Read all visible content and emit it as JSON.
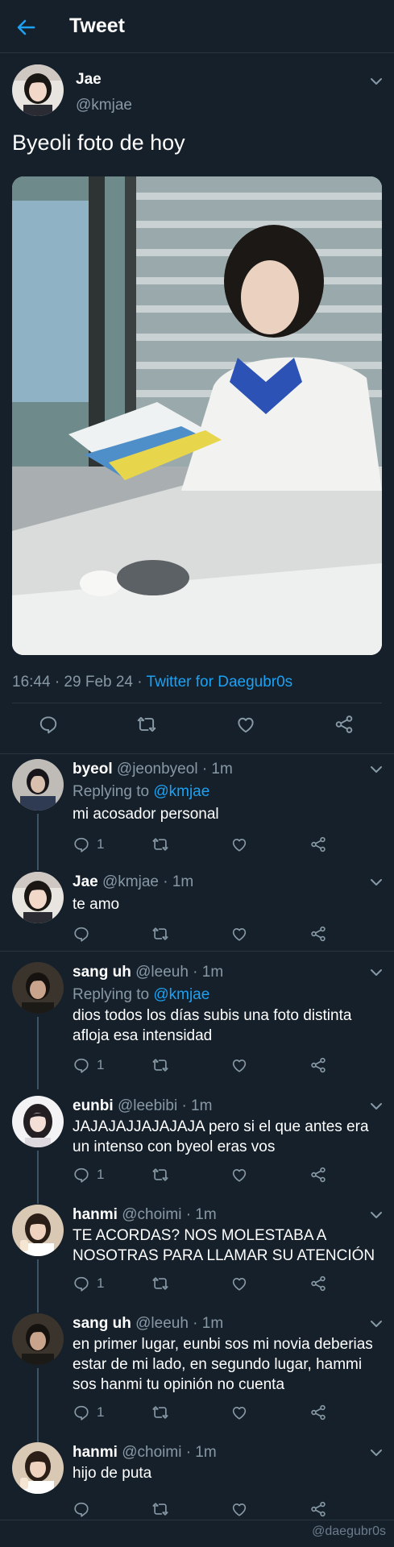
{
  "header": {
    "title": "Tweet",
    "back_icon": "arrow-left-icon",
    "accent": "#1da1f2"
  },
  "main_tweet": {
    "name": "Jae",
    "handle": "@kmjae",
    "text": "Byeoli foto de hoy",
    "time": "16:44 · 29 Feb 24 · ",
    "source": "Twitter for Daegubr0s"
  },
  "replies": [
    {
      "name": "byeol",
      "handle": "@jeonbyeol · 1m",
      "replying_prefix": "Replying to ",
      "replying_to": "@kmjae",
      "lines": [
        "mi acosador personal"
      ],
      "reply_count": "1"
    },
    {
      "name": "Jae",
      "handle": "@kmjae · 1m",
      "lines": [
        "te amo"
      ],
      "reply_count": ""
    },
    {
      "name": "sang uh",
      "handle": "@leeuh · 1m",
      "replying_prefix": "Replying to ",
      "replying_to": "@kmjae",
      "lines": [
        "dios todos los días subis una foto distinta",
        "afloja esa intensidad"
      ],
      "reply_count": "1"
    },
    {
      "name": "eunbi",
      "handle": "@leebibi · 1m",
      "lines": [
        "JAJAJAJJAJAJAJA pero si el que antes era",
        "un intenso con byeol eras vos"
      ],
      "reply_count": "1"
    },
    {
      "name": "hanmi",
      "handle": "@choimi · 1m",
      "lines": [
        "TE ACORDAS? NOS MOLESTABA A",
        "NOSOTRAS PARA LLAMAR SU ATENCIÓN"
      ],
      "reply_count": "1"
    },
    {
      "name": "sang uh",
      "handle": "@leeuh · 1m",
      "lines": [
        "en primer lugar, eunbi sos mi novia deberias",
        "estar de mi lado, en segundo lugar, hammi",
        "sos hanmi tu opinión no cuenta"
      ],
      "reply_count": "1"
    },
    {
      "name": "hanmi",
      "handle": "@choimi · 1m",
      "lines": [
        "hijo de puta"
      ],
      "reply_count": ""
    }
  ],
  "watermark": "@daegubr0s"
}
